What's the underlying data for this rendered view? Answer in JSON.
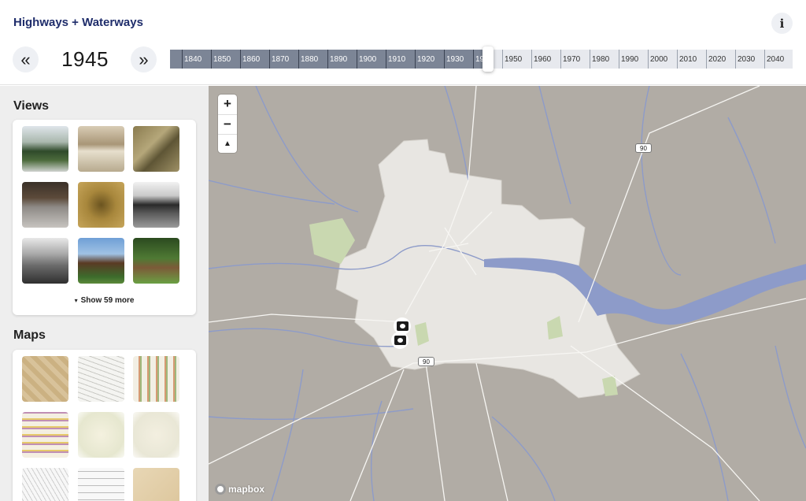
{
  "header": {
    "title": "Highways + Waterways",
    "info_label": "i",
    "prev_label": "«",
    "next_label": "»",
    "year": "1945"
  },
  "timeline": {
    "ticks": [
      "1840",
      "1850",
      "1860",
      "1870",
      "1880",
      "1890",
      "1900",
      "1910",
      "1920",
      "1930",
      "1940",
      "1950",
      "1960",
      "1970",
      "1980",
      "1990",
      "2000",
      "2010",
      "2020",
      "2030",
      "2040"
    ],
    "selected_year": 1945,
    "colors": {
      "past": "#7c8596",
      "future": "#e7e9ee"
    }
  },
  "sidebar": {
    "views_title": "Views",
    "show_more_caret": "▾",
    "show_more": "Show 59 more",
    "maps_title": "Maps"
  },
  "map": {
    "zoom_in": "+",
    "zoom_out": "−",
    "compass": "▲",
    "shield_a": "90",
    "shield_b": "90",
    "attribution": "mapbox",
    "colors": {
      "land": "#b1aca5",
      "city": "#e8e6e2",
      "water": "#8d9bc9",
      "park": "#c9d8b0"
    }
  }
}
